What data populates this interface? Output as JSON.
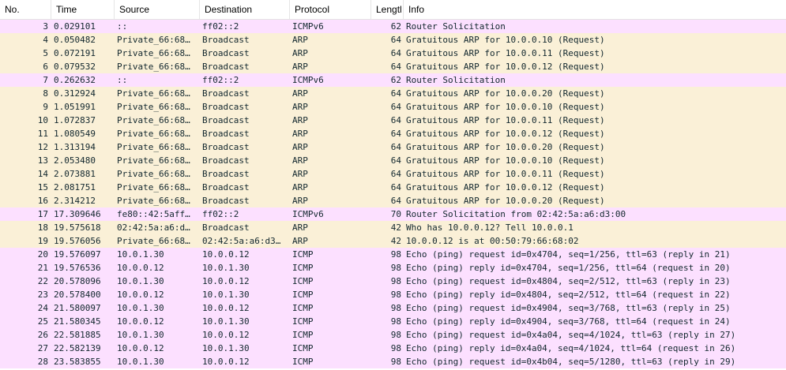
{
  "columns": {
    "no": "No.",
    "time": "Time",
    "source": "Source",
    "destination": "Destination",
    "protocol": "Protocol",
    "length": "Lengtl",
    "info": "Info"
  },
  "colors": {
    "icmpv6": "#fce0ff",
    "arp": "#faf0d7",
    "icmp": "#fce0ff",
    "text": "#12272e"
  },
  "packets": [
    {
      "no": "3",
      "time": "0.029101",
      "source": "::",
      "destination": "ff02::2",
      "protocol": "ICMPv6",
      "length": "62",
      "info": "Router Solicitation"
    },
    {
      "no": "4",
      "time": "0.050482",
      "source": "Private_66:68…",
      "destination": "Broadcast",
      "protocol": "ARP",
      "length": "64",
      "info": "Gratuitous ARP for 10.0.0.10 (Request)"
    },
    {
      "no": "5",
      "time": "0.072191",
      "source": "Private_66:68…",
      "destination": "Broadcast",
      "protocol": "ARP",
      "length": "64",
      "info": "Gratuitous ARP for 10.0.0.11 (Request)"
    },
    {
      "no": "6",
      "time": "0.079532",
      "source": "Private_66:68…",
      "destination": "Broadcast",
      "protocol": "ARP",
      "length": "64",
      "info": "Gratuitous ARP for 10.0.0.12 (Request)"
    },
    {
      "no": "7",
      "time": "0.262632",
      "source": "::",
      "destination": "ff02::2",
      "protocol": "ICMPv6",
      "length": "62",
      "info": "Router Solicitation"
    },
    {
      "no": "8",
      "time": "0.312924",
      "source": "Private_66:68…",
      "destination": "Broadcast",
      "protocol": "ARP",
      "length": "64",
      "info": "Gratuitous ARP for 10.0.0.20 (Request)"
    },
    {
      "no": "9",
      "time": "1.051991",
      "source": "Private_66:68…",
      "destination": "Broadcast",
      "protocol": "ARP",
      "length": "64",
      "info": "Gratuitous ARP for 10.0.0.10 (Request)"
    },
    {
      "no": "10",
      "time": "1.072837",
      "source": "Private_66:68…",
      "destination": "Broadcast",
      "protocol": "ARP",
      "length": "64",
      "info": "Gratuitous ARP for 10.0.0.11 (Request)"
    },
    {
      "no": "11",
      "time": "1.080549",
      "source": "Private_66:68…",
      "destination": "Broadcast",
      "protocol": "ARP",
      "length": "64",
      "info": "Gratuitous ARP for 10.0.0.12 (Request)"
    },
    {
      "no": "12",
      "time": "1.313194",
      "source": "Private_66:68…",
      "destination": "Broadcast",
      "protocol": "ARP",
      "length": "64",
      "info": "Gratuitous ARP for 10.0.0.20 (Request)"
    },
    {
      "no": "13",
      "time": "2.053480",
      "source": "Private_66:68…",
      "destination": "Broadcast",
      "protocol": "ARP",
      "length": "64",
      "info": "Gratuitous ARP for 10.0.0.10 (Request)"
    },
    {
      "no": "14",
      "time": "2.073881",
      "source": "Private_66:68…",
      "destination": "Broadcast",
      "protocol": "ARP",
      "length": "64",
      "info": "Gratuitous ARP for 10.0.0.11 (Request)"
    },
    {
      "no": "15",
      "time": "2.081751",
      "source": "Private_66:68…",
      "destination": "Broadcast",
      "protocol": "ARP",
      "length": "64",
      "info": "Gratuitous ARP for 10.0.0.12 (Request)"
    },
    {
      "no": "16",
      "time": "2.314212",
      "source": "Private_66:68…",
      "destination": "Broadcast",
      "protocol": "ARP",
      "length": "64",
      "info": "Gratuitous ARP for 10.0.0.20 (Request)"
    },
    {
      "no": "17",
      "time": "17.309646",
      "source": "fe80::42:5aff…",
      "destination": "ff02::2",
      "protocol": "ICMPv6",
      "length": "70",
      "info": "Router Solicitation from 02:42:5a:a6:d3:00"
    },
    {
      "no": "18",
      "time": "19.575618",
      "source": "02:42:5a:a6:d…",
      "destination": "Broadcast",
      "protocol": "ARP",
      "length": "42",
      "info": "Who has 10.0.0.12? Tell 10.0.0.1"
    },
    {
      "no": "19",
      "time": "19.576056",
      "source": "Private_66:68…",
      "destination": "02:42:5a:a6:d3…",
      "protocol": "ARP",
      "length": "42",
      "info": "10.0.0.12 is at 00:50:79:66:68:02"
    },
    {
      "no": "20",
      "time": "19.576097",
      "source": "10.0.1.30",
      "destination": "10.0.0.12",
      "protocol": "ICMP",
      "length": "98",
      "info": "Echo (ping) request  id=0x4704, seq=1/256, ttl=63 (reply in 21)"
    },
    {
      "no": "21",
      "time": "19.576536",
      "source": "10.0.0.12",
      "destination": "10.0.1.30",
      "protocol": "ICMP",
      "length": "98",
      "info": "Echo (ping) reply    id=0x4704, seq=1/256, ttl=64 (request in 20)"
    },
    {
      "no": "22",
      "time": "20.578096",
      "source": "10.0.1.30",
      "destination": "10.0.0.12",
      "protocol": "ICMP",
      "length": "98",
      "info": "Echo (ping) request  id=0x4804, seq=2/512, ttl=63 (reply in 23)"
    },
    {
      "no": "23",
      "time": "20.578400",
      "source": "10.0.0.12",
      "destination": "10.0.1.30",
      "protocol": "ICMP",
      "length": "98",
      "info": "Echo (ping) reply    id=0x4804, seq=2/512, ttl=64 (request in 22)"
    },
    {
      "no": "24",
      "time": "21.580097",
      "source": "10.0.1.30",
      "destination": "10.0.0.12",
      "protocol": "ICMP",
      "length": "98",
      "info": "Echo (ping) request  id=0x4904, seq=3/768, ttl=63 (reply in 25)"
    },
    {
      "no": "25",
      "time": "21.580345",
      "source": "10.0.0.12",
      "destination": "10.0.1.30",
      "protocol": "ICMP",
      "length": "98",
      "info": "Echo (ping) reply    id=0x4904, seq=3/768, ttl=64 (request in 24)"
    },
    {
      "no": "26",
      "time": "22.581885",
      "source": "10.0.1.30",
      "destination": "10.0.0.12",
      "protocol": "ICMP",
      "length": "98",
      "info": "Echo (ping) request  id=0x4a04, seq=4/1024, ttl=63 (reply in 27)"
    },
    {
      "no": "27",
      "time": "22.582139",
      "source": "10.0.0.12",
      "destination": "10.0.1.30",
      "protocol": "ICMP",
      "length": "98",
      "info": "Echo (ping) reply    id=0x4a04, seq=4/1024, ttl=64 (request in 26)"
    },
    {
      "no": "28",
      "time": "23.583855",
      "source": "10.0.1.30",
      "destination": "10.0.0.12",
      "protocol": "ICMP",
      "length": "98",
      "info": "Echo (ping) request  id=0x4b04, seq=5/1280, ttl=63 (reply in 29)"
    }
  ]
}
